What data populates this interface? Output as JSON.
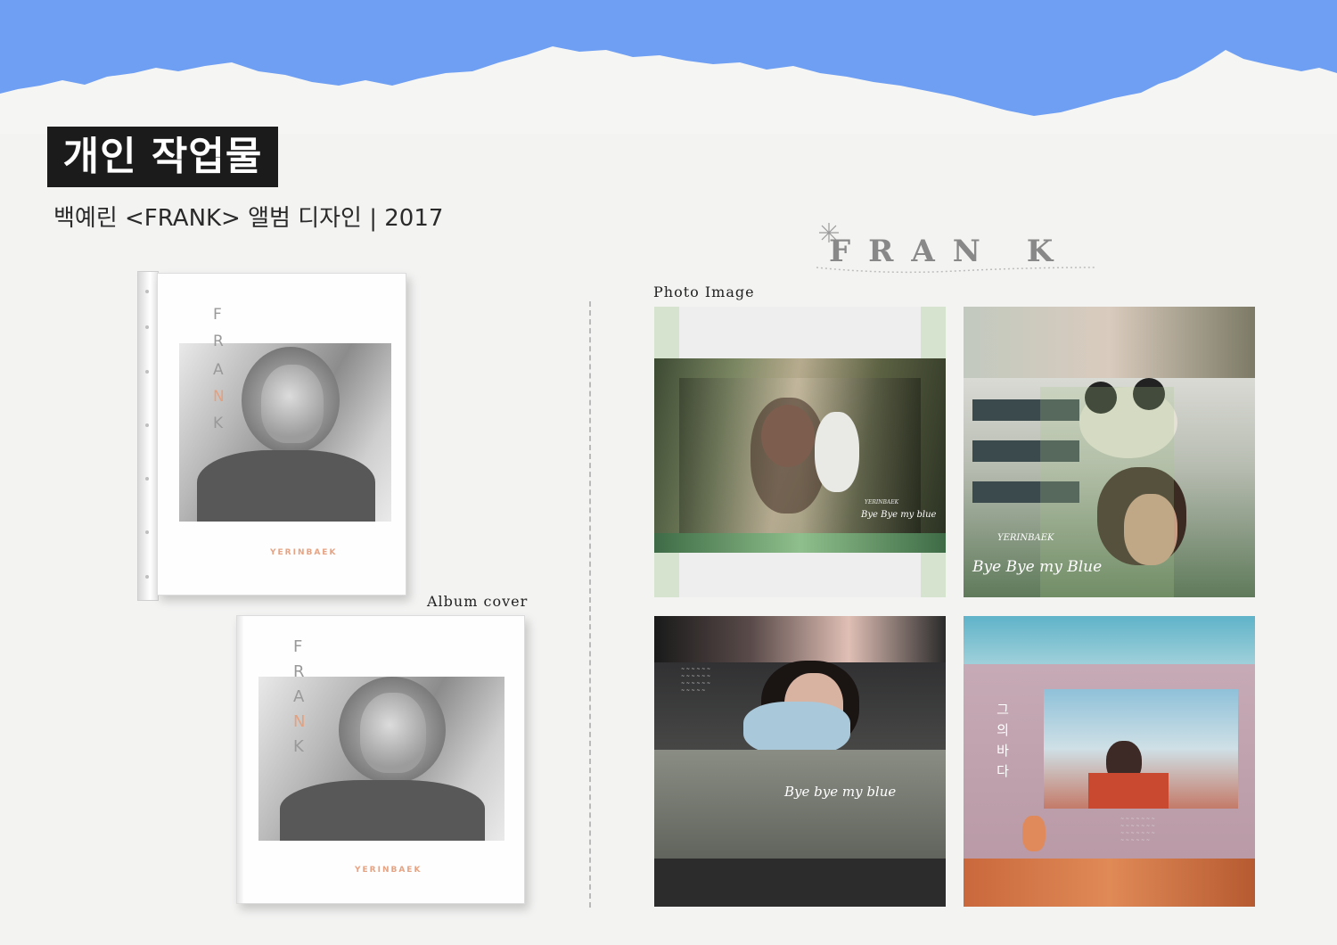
{
  "header": {
    "tag": "개인 작업물",
    "subtitle": "백예린 <FRANK> 앨범 디자인 | 2017"
  },
  "brand": {
    "title": "FRAN K"
  },
  "captions": {
    "photo_image": "Photo Image",
    "album_cover": "Album cover"
  },
  "album": {
    "letters": [
      "F",
      "R",
      "A",
      "N",
      "K"
    ],
    "artist_mark": "YERINBAEK"
  },
  "tiles": {
    "tile1": {
      "mark": "YERINBAEK",
      "script": "Bye Bye my blue"
    },
    "tile2": {
      "mark": "YERINBAEK",
      "script": "Bye Bye my Blue"
    },
    "tile3": {
      "script": "Bye bye my blue"
    },
    "tile4": {
      "vertical_title": [
        "그",
        "의",
        "바",
        "다"
      ]
    }
  },
  "colors": {
    "sky": "#6f9ff2",
    "paper": "#f3f3f2",
    "tag_bg": "#1b1b1b",
    "accent_peach": "#e5a07e"
  }
}
